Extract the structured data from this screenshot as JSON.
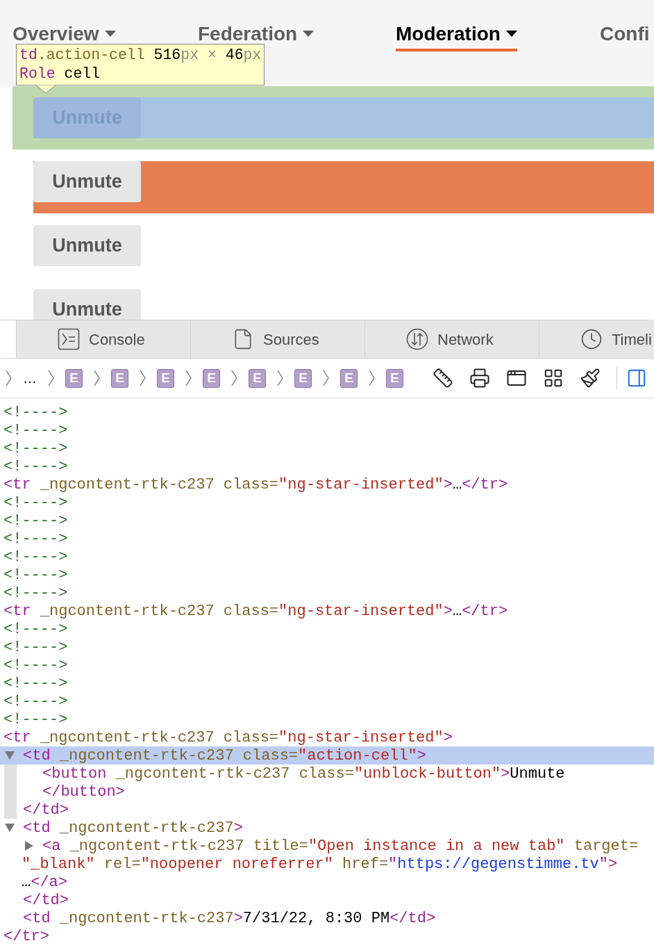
{
  "nav": {
    "items": [
      {
        "label": "Overview",
        "selected": false,
        "dropdown": true
      },
      {
        "label": "Federation",
        "selected": false,
        "dropdown": true
      },
      {
        "label": "Moderation",
        "selected": true,
        "dropdown": true
      },
      {
        "label": "Confi",
        "selected": false,
        "dropdown": false
      }
    ]
  },
  "inspector_tooltip": {
    "lines": [
      [
        {
          "kind": "tag",
          "text": "td"
        },
        {
          "kind": "attr",
          "text": ".action-cell"
        },
        {
          "kind": "text",
          "text": " 516"
        },
        {
          "kind": "unit",
          "text": "px"
        },
        {
          "kind": "unit",
          "text": " × "
        },
        {
          "kind": "text",
          "text": "46"
        },
        {
          "kind": "unit",
          "text": "px"
        }
      ],
      [
        {
          "kind": "tag",
          "text": "Role"
        },
        {
          "kind": "text",
          "text": " cell"
        }
      ]
    ]
  },
  "rows": [
    {
      "button": "Unmute",
      "kind": "inspected"
    },
    {
      "button": "Unmute",
      "kind": "hovered"
    },
    {
      "button": "Unmute",
      "kind": "plain"
    },
    {
      "button": "Unmute",
      "kind": "plain"
    }
  ],
  "devtools": {
    "tabs": [
      {
        "label": "Console",
        "kind": "console"
      },
      {
        "label": "Sources",
        "kind": "sources"
      },
      {
        "label": "Network",
        "kind": "network"
      },
      {
        "label": "Timeli",
        "kind": "timelines"
      }
    ],
    "breadcrumb": {
      "ellipsis": "…",
      "elements": [
        "E",
        "E",
        "E",
        "E",
        "E",
        "E",
        "E",
        "E"
      ]
    },
    "tools": [
      {
        "kind": "ruler",
        "selected": false
      },
      {
        "kind": "print",
        "selected": false
      },
      {
        "kind": "window",
        "selected": false
      },
      {
        "kind": "grid",
        "selected": false
      },
      {
        "kind": "brush",
        "selected": false
      },
      {
        "kind": "sidebar",
        "selected": true
      }
    ],
    "dom_tree": [
      {
        "selected": false,
        "lines": [
          [
            {
              "kind": "comment",
              "text": "<!---->"
            }
          ]
        ]
      },
      {
        "selected": false,
        "lines": [
          [
            {
              "kind": "comment",
              "text": "<!---->"
            }
          ]
        ]
      },
      {
        "selected": false,
        "lines": [
          [
            {
              "kind": "comment",
              "text": "<!---->"
            }
          ]
        ]
      },
      {
        "selected": false,
        "lines": [
          [
            {
              "kind": "comment",
              "text": "<!---->"
            }
          ]
        ]
      },
      {
        "selected": false,
        "lines": [
          [
            {
              "kind": "tag",
              "text": "<tr"
            },
            {
              "kind": "attr",
              "text": " _ngcontent-rtk-c237 class="
            },
            {
              "kind": "value",
              "text": "\"ng-star-inserted\""
            },
            {
              "kind": "tag",
              "text": ">"
            },
            {
              "kind": "text",
              "text": "…"
            },
            {
              "kind": "tag",
              "text": "</tr>"
            }
          ]
        ]
      },
      {
        "selected": false,
        "lines": [
          [
            {
              "kind": "comment",
              "text": "<!---->"
            }
          ]
        ]
      },
      {
        "selected": false,
        "lines": [
          [
            {
              "kind": "comment",
              "text": "<!---->"
            }
          ]
        ]
      },
      {
        "selected": false,
        "lines": [
          [
            {
              "kind": "comment",
              "text": "<!---->"
            }
          ]
        ]
      },
      {
        "selected": false,
        "lines": [
          [
            {
              "kind": "comment",
              "text": "<!---->"
            }
          ]
        ]
      },
      {
        "selected": false,
        "lines": [
          [
            {
              "kind": "comment",
              "text": "<!---->"
            }
          ]
        ]
      },
      {
        "selected": false,
        "lines": [
          [
            {
              "kind": "comment",
              "text": "<!---->"
            }
          ]
        ]
      },
      {
        "selected": false,
        "lines": [
          [
            {
              "kind": "tag",
              "text": "<tr"
            },
            {
              "kind": "attr",
              "text": " _ngcontent-rtk-c237 class="
            },
            {
              "kind": "value",
              "text": "\"ng-star-inserted\""
            },
            {
              "kind": "tag",
              "text": ">"
            },
            {
              "kind": "text",
              "text": "…"
            },
            {
              "kind": "tag",
              "text": "</tr>"
            }
          ]
        ]
      },
      {
        "selected": false,
        "lines": [
          [
            {
              "kind": "comment",
              "text": "<!---->"
            }
          ]
        ]
      },
      {
        "selected": false,
        "lines": [
          [
            {
              "kind": "comment",
              "text": "<!---->"
            }
          ]
        ]
      },
      {
        "selected": false,
        "lines": [
          [
            {
              "kind": "comment",
              "text": "<!---->"
            }
          ]
        ]
      },
      {
        "selected": false,
        "lines": [
          [
            {
              "kind": "comment",
              "text": "<!---->"
            }
          ]
        ]
      },
      {
        "selected": false,
        "lines": [
          [
            {
              "kind": "comment",
              "text": "<!---->"
            }
          ]
        ]
      },
      {
        "selected": false,
        "lines": [
          [
            {
              "kind": "comment",
              "text": "<!---->"
            }
          ]
        ]
      },
      {
        "selected": false,
        "lines": [
          [
            {
              "kind": "tag",
              "text": "<tr"
            },
            {
              "kind": "attr",
              "text": " _ngcontent-rtk-c237 class="
            },
            {
              "kind": "value",
              "text": "\"ng-star-inserted\""
            },
            {
              "kind": "tag",
              "text": ">"
            }
          ]
        ],
        "closing": [
          {
            "kind": "tag",
            "text": "</tr>"
          }
        ],
        "children": [
          {
            "expanded": true,
            "selected": true,
            "lines": [
              [
                {
                  "kind": "tag",
                  "text": "<td"
                },
                {
                  "kind": "attr",
                  "text": " _ngcontent-rtk-c237 class="
                },
                {
                  "kind": "value",
                  "text": "\"action-cell\""
                },
                {
                  "kind": "tag",
                  "text": ">"
                }
              ]
            ],
            "closing": [
              {
                "kind": "tag",
                "text": "</td>"
              }
            ],
            "children": [
              {
                "selected": false,
                "lines": [
                  [
                    {
                      "kind": "tag",
                      "text": "<button"
                    },
                    {
                      "kind": "attr",
                      "text": " _ngcontent-rtk-c237 class="
                    },
                    {
                      "kind": "value",
                      "text": "\"unblock-button\""
                    },
                    {
                      "kind": "tag",
                      "text": ">"
                    },
                    {
                      "kind": "text",
                      "text": "Unmute"
                    }
                  ]
                ],
                "closing": [
                  {
                    "kind": "tag",
                    "text": "</button>"
                  }
                ]
              }
            ]
          },
          {
            "expanded": true,
            "selected": false,
            "lines": [
              [
                {
                  "kind": "tag",
                  "text": "<td"
                },
                {
                  "kind": "attr",
                  "text": " _ngcontent-rtk-c237"
                },
                {
                  "kind": "tag",
                  "text": ">"
                }
              ]
            ],
            "closing": [
              {
                "kind": "tag",
                "text": "</td>"
              }
            ],
            "children": [
              {
                "expanded": false,
                "selected": false,
                "lines": [
                  [
                    {
                      "kind": "tag",
                      "text": "<a"
                    },
                    {
                      "kind": "attr",
                      "text": " _ngcontent-rtk-c237 title="
                    },
                    {
                      "kind": "value",
                      "text": "\"Open instance in a new tab\""
                    },
                    {
                      "kind": "attr",
                      "text": " target="
                    }
                  ],
                  [
                    {
                      "kind": "value",
                      "text": "\"_blank\""
                    },
                    {
                      "kind": "attr",
                      "text": " rel="
                    },
                    {
                      "kind": "value",
                      "text": "\"noopener noreferrer\""
                    },
                    {
                      "kind": "attr",
                      "text": " href="
                    },
                    {
                      "kind": "tag",
                      "text": "\""
                    },
                    {
                      "kind": "url",
                      "text": "https://gegenstimme.tv"
                    },
                    {
                      "kind": "tag",
                      "text": "\">"
                    }
                  ],
                  [
                    {
                      "kind": "text",
                      "text": "…"
                    },
                    {
                      "kind": "tag",
                      "text": "</a>"
                    }
                  ]
                ]
              }
            ]
          },
          {
            "selected": false,
            "lines": [
              [
                {
                  "kind": "tag",
                  "text": "<td"
                },
                {
                  "kind": "attr",
                  "text": " _ngcontent-rtk-c237"
                },
                {
                  "kind": "tag",
                  "text": ">"
                },
                {
                  "kind": "text",
                  "text": "7/31/22, 8:30 PM"
                },
                {
                  "kind": "tag",
                  "text": "</td>"
                }
              ]
            ]
          }
        ]
      }
    ]
  }
}
